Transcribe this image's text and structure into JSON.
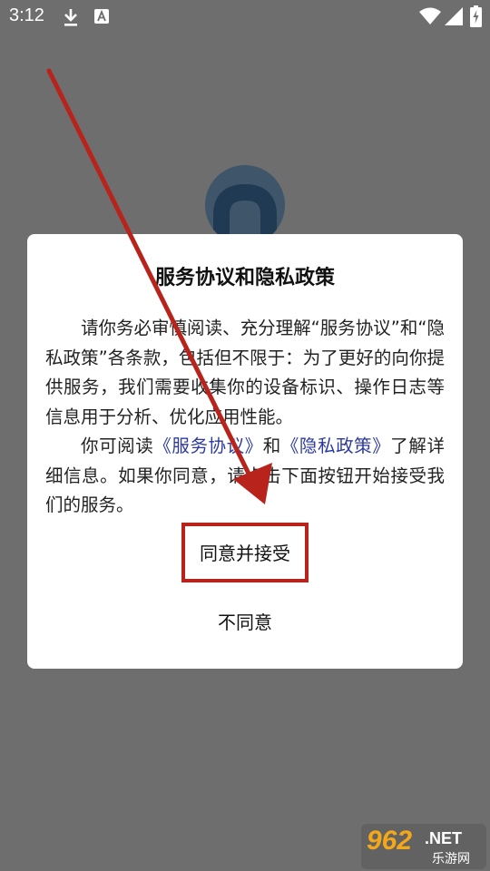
{
  "status_bar": {
    "time": "3:12",
    "icons": [
      "download-icon",
      "a-notification-icon",
      "wifi-icon",
      "signal-icon",
      "battery-charging-icon"
    ]
  },
  "dialog": {
    "title": "服务协议和隐私政策",
    "para1": "请你务必审慎阅读、充分理解“服务协议”和“隐私政策”各条款，包括但不限于：为了更好的向你提供服务，我们需要收集你的设备标识、操作日志等信息用于分析、优化应用性能。",
    "para2_prefix": "你可阅读",
    "service_link": "《服务协议》",
    "para2_and": "和",
    "privacy_link": "《隐私政策》",
    "para2_suffix": "了解详细信息。如果你同意，请点击下面按钮开始接受我们的服务。",
    "agree_label": "同意并接受",
    "disagree_label": "不同意"
  },
  "annotation": {
    "color": "#b8241c"
  },
  "watermark": {
    "number": "962",
    "domain": ".NET",
    "subtitle": "乐游网"
  }
}
